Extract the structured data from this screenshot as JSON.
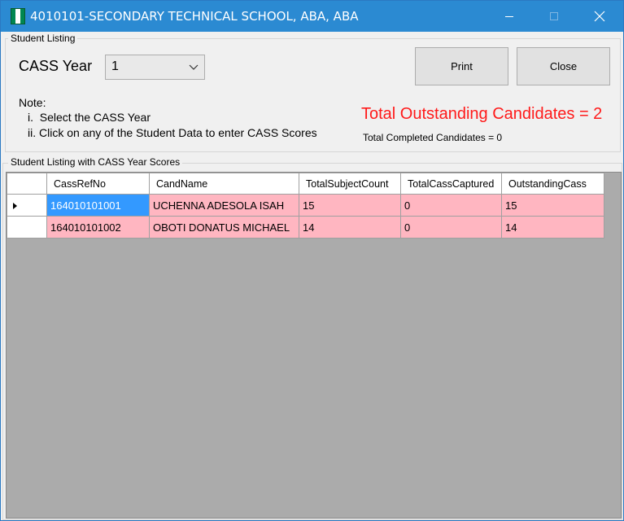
{
  "window": {
    "title": "4010101-SECONDARY TECHNICAL SCHOOL, ABA, ABA",
    "icon": "nigeria-flag-icon",
    "flag_colors": [
      "#008751",
      "#ffffff",
      "#008751"
    ]
  },
  "student_listing": {
    "group_label": "Student Listing",
    "cass_year_label": "CASS Year",
    "cass_year_value": "1",
    "print_label": "Print",
    "close_label": "Close",
    "note_title": "Note:",
    "note_lines": [
      "i.  Select the CASS Year",
      "ii. Click on any of the Student Data to enter CASS Scores"
    ],
    "total_outstanding": "Total Outstanding Candidates = 2",
    "total_completed": "Total Completed Candidates = 0"
  },
  "grid": {
    "group_label": "Student Listing with CASS Year Scores",
    "columns": [
      "CassRefNo",
      "CandName",
      "TotalSubjectCount",
      "TotalCassCaptured",
      "OutstandingCass"
    ],
    "rows": [
      [
        "164010101001",
        "UCHENNA ADESOLA ISAH",
        "15",
        "0",
        "15"
      ],
      [
        "164010101002",
        "OBOTI DONATUS MICHAEL",
        "14",
        "0",
        "14"
      ]
    ]
  },
  "colors": {
    "title_bar": "#2b8ad2",
    "row_highlight": "#ffb6c1",
    "selection": "#3399ff",
    "outstanding_text": "#ff1a1a",
    "grid_background": "#ababab"
  }
}
